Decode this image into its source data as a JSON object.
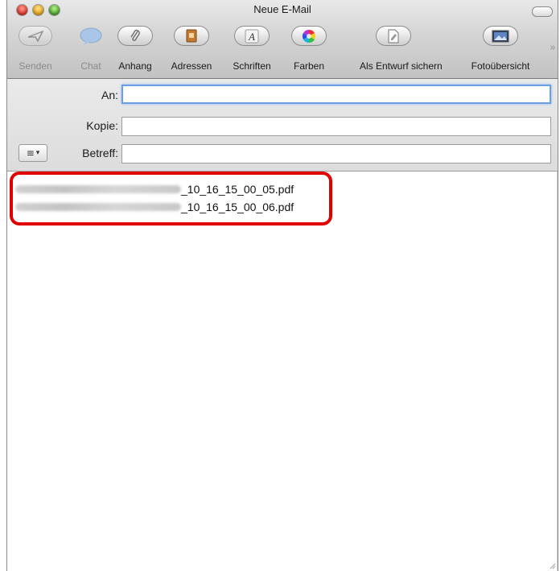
{
  "window": {
    "title": "Neue E-Mail"
  },
  "toolbar": {
    "items": [
      {
        "label": "Senden",
        "icon": "send-icon",
        "enabled": false
      },
      {
        "label": "Chat",
        "icon": "chat-bubble-icon",
        "enabled": false
      },
      {
        "label": "Anhang",
        "icon": "paperclip-icon",
        "enabled": true
      },
      {
        "label": "Adressen",
        "icon": "address-book-icon",
        "enabled": true
      },
      {
        "label": "Schriften",
        "icon": "font-icon",
        "enabled": true
      },
      {
        "label": "Farben",
        "icon": "color-wheel-icon",
        "enabled": true
      },
      {
        "label": "Als Entwurf sichern",
        "icon": "draft-icon",
        "enabled": true
      },
      {
        "label": "Fotoübersicht",
        "icon": "photo-browser-icon",
        "enabled": true
      }
    ],
    "overflow_glyph": "»"
  },
  "header": {
    "to_label": "An:",
    "cc_label": "Kopie:",
    "subject_label": "Betreff:",
    "to_value": "",
    "cc_value": "",
    "subject_value": "",
    "menu_glyph": "≡",
    "menu_arrow": "▾"
  },
  "attachments": [
    {
      "name_suffix": "_10_16_15_00_05.pdf"
    },
    {
      "name_suffix": "_10_16_15_00_06.pdf"
    }
  ],
  "colors": {
    "highlight": "#e00000",
    "focus": "#6a9fe6"
  }
}
